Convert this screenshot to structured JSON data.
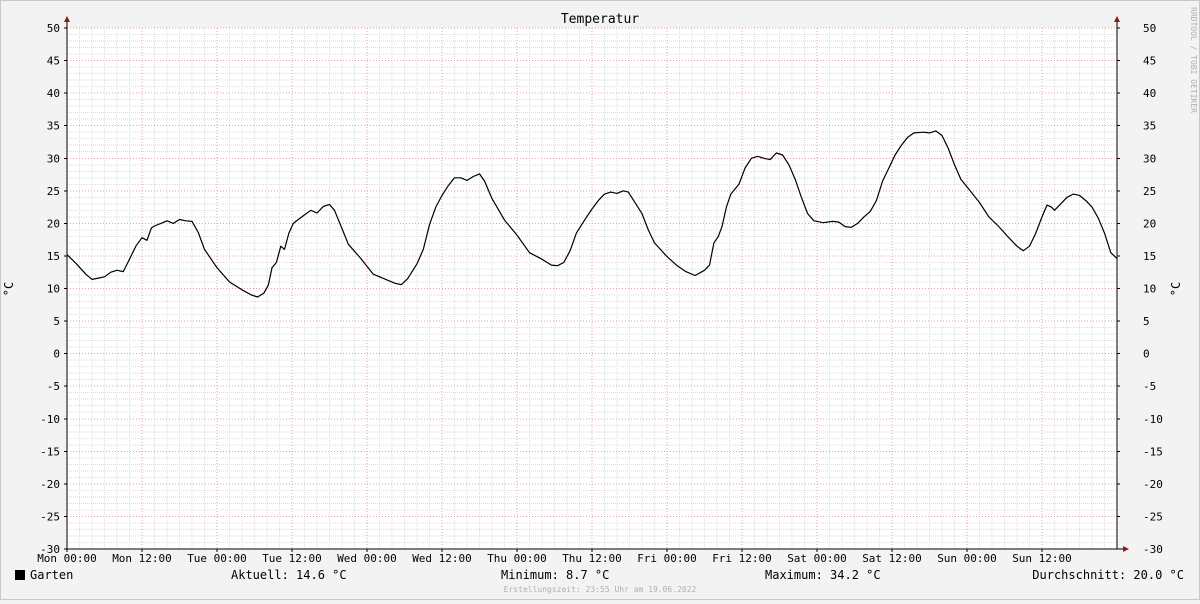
{
  "chart_data": {
    "type": "line",
    "title": "Temperatur",
    "ylabel": "°C",
    "ylim": [
      -30,
      50
    ],
    "yticks": [
      50,
      45,
      40,
      35,
      30,
      25,
      20,
      15,
      10,
      5,
      0,
      -5,
      -10,
      -15,
      -20,
      -25,
      -30
    ],
    "xlim": [
      0,
      168
    ],
    "xticks": [
      {
        "x": 0,
        "label": "Mon 00:00"
      },
      {
        "x": 12,
        "label": "Mon 12:00"
      },
      {
        "x": 24,
        "label": "Tue 00:00"
      },
      {
        "x": 36,
        "label": "Tue 12:00"
      },
      {
        "x": 48,
        "label": "Wed 00:00"
      },
      {
        "x": 60,
        "label": "Wed 12:00"
      },
      {
        "x": 72,
        "label": "Thu 00:00"
      },
      {
        "x": 84,
        "label": "Thu 12:00"
      },
      {
        "x": 96,
        "label": "Fri 00:00"
      },
      {
        "x": 108,
        "label": "Fri 12:00"
      },
      {
        "x": 120,
        "label": "Sat 00:00"
      },
      {
        "x": 132,
        "label": "Sat 12:00"
      },
      {
        "x": 144,
        "label": "Sun 00:00"
      },
      {
        "x": 156,
        "label": "Sun 12:00"
      }
    ],
    "grid": true,
    "series": [
      {
        "name": "Garten",
        "color": "#000000",
        "points": [
          [
            0,
            15.2
          ],
          [
            1.5,
            13.8
          ],
          [
            3,
            12.2
          ],
          [
            4,
            11.4
          ],
          [
            5,
            11.6
          ],
          [
            6,
            11.8
          ],
          [
            7,
            12.5
          ],
          [
            8,
            12.8
          ],
          [
            9,
            12.6
          ],
          [
            10,
            14.5
          ],
          [
            11,
            16.5
          ],
          [
            12,
            17.8
          ],
          [
            12.8,
            17.4
          ],
          [
            13.5,
            19.3
          ],
          [
            14,
            19.6
          ],
          [
            15,
            20.0
          ],
          [
            16,
            20.4
          ],
          [
            17,
            20.0
          ],
          [
            18,
            20.6
          ],
          [
            19,
            20.4
          ],
          [
            20,
            20.3
          ],
          [
            21,
            18.6
          ],
          [
            22,
            16.0
          ],
          [
            24,
            13.2
          ],
          [
            26,
            11.0
          ],
          [
            28,
            9.8
          ],
          [
            29.5,
            9.0
          ],
          [
            30.5,
            8.7
          ],
          [
            31.5,
            9.3
          ],
          [
            32.2,
            10.5
          ],
          [
            32.8,
            13.2
          ],
          [
            33.5,
            14.0
          ],
          [
            34.2,
            16.5
          ],
          [
            34.8,
            16.0
          ],
          [
            35.5,
            18.5
          ],
          [
            36.2,
            20.0
          ],
          [
            37,
            20.6
          ],
          [
            38,
            21.3
          ],
          [
            39,
            22.0
          ],
          [
            40,
            21.6
          ],
          [
            41,
            22.6
          ],
          [
            42,
            22.9
          ],
          [
            42.8,
            22.0
          ],
          [
            44,
            19.2
          ],
          [
            45,
            16.8
          ],
          [
            47,
            14.6
          ],
          [
            49,
            12.2
          ],
          [
            51,
            11.4
          ],
          [
            52.5,
            10.8
          ],
          [
            53.5,
            10.6
          ],
          [
            54.5,
            11.5
          ],
          [
            56,
            13.8
          ],
          [
            57,
            16.0
          ],
          [
            58,
            19.8
          ],
          [
            59,
            22.5
          ],
          [
            60,
            24.3
          ],
          [
            61,
            25.8
          ],
          [
            62,
            27.0
          ],
          [
            63,
            27.0
          ],
          [
            64,
            26.6
          ],
          [
            65,
            27.2
          ],
          [
            66,
            27.6
          ],
          [
            66.8,
            26.5
          ],
          [
            68,
            23.8
          ],
          [
            70,
            20.5
          ],
          [
            72,
            18.2
          ],
          [
            74,
            15.5
          ],
          [
            76,
            14.5
          ],
          [
            77.5,
            13.6
          ],
          [
            78.5,
            13.5
          ],
          [
            79.5,
            14.0
          ],
          [
            80.5,
            15.8
          ],
          [
            81.5,
            18.5
          ],
          [
            83,
            20.8
          ],
          [
            84,
            22.2
          ],
          [
            85,
            23.5
          ],
          [
            86,
            24.5
          ],
          [
            87,
            24.8
          ],
          [
            88,
            24.6
          ],
          [
            89,
            25.0
          ],
          [
            89.8,
            24.8
          ],
          [
            91,
            23.0
          ],
          [
            92,
            21.5
          ],
          [
            93,
            19.0
          ],
          [
            94,
            17.0
          ],
          [
            96,
            14.9
          ],
          [
            97.5,
            13.6
          ],
          [
            99,
            12.6
          ],
          [
            100.5,
            12.0
          ],
          [
            102,
            12.8
          ],
          [
            102.8,
            13.6
          ],
          [
            103.5,
            17.0
          ],
          [
            104.2,
            18.0
          ],
          [
            104.8,
            19.5
          ],
          [
            105.5,
            22.5
          ],
          [
            106.2,
            24.5
          ],
          [
            107.5,
            26.0
          ],
          [
            108.5,
            28.5
          ],
          [
            109.5,
            30.0
          ],
          [
            110.5,
            30.3
          ],
          [
            111.5,
            30.0
          ],
          [
            112.5,
            29.8
          ],
          [
            113.5,
            30.8
          ],
          [
            114.5,
            30.5
          ],
          [
            115.5,
            29.0
          ],
          [
            116.5,
            26.8
          ],
          [
            117.5,
            24.0
          ],
          [
            118.5,
            21.5
          ],
          [
            119.5,
            20.4
          ],
          [
            121,
            20.1
          ],
          [
            122.5,
            20.3
          ],
          [
            123.5,
            20.2
          ],
          [
            124.5,
            19.5
          ],
          [
            125.5,
            19.4
          ],
          [
            126.5,
            20.0
          ],
          [
            127.5,
            21.0
          ],
          [
            128.5,
            21.8
          ],
          [
            129.5,
            23.5
          ],
          [
            130.5,
            26.5
          ],
          [
            131.5,
            28.5
          ],
          [
            132.5,
            30.5
          ],
          [
            133.5,
            32.0
          ],
          [
            134.5,
            33.2
          ],
          [
            135.5,
            33.9
          ],
          [
            137,
            34.0
          ],
          [
            138,
            33.9
          ],
          [
            139,
            34.2
          ],
          [
            140,
            33.5
          ],
          [
            141,
            31.5
          ],
          [
            142,
            29.0
          ],
          [
            143,
            26.8
          ],
          [
            144.5,
            25.0
          ],
          [
            146,
            23.2
          ],
          [
            147.5,
            21.0
          ],
          [
            149,
            19.6
          ],
          [
            150.5,
            18.0
          ],
          [
            152,
            16.5
          ],
          [
            153,
            15.8
          ],
          [
            154,
            16.5
          ],
          [
            155,
            18.5
          ],
          [
            156,
            21.0
          ],
          [
            156.8,
            22.8
          ],
          [
            157.5,
            22.5
          ],
          [
            158,
            22.0
          ],
          [
            159,
            23.0
          ],
          [
            160,
            24.0
          ],
          [
            161,
            24.5
          ],
          [
            162,
            24.3
          ],
          [
            163,
            23.5
          ],
          [
            164,
            22.5
          ],
          [
            165,
            20.8
          ],
          [
            166,
            18.5
          ],
          [
            167,
            15.5
          ],
          [
            168,
            14.6
          ]
        ]
      }
    ]
  },
  "watermark": "RRDTOOL / TOBI OETIKER",
  "legend": {
    "series_name": "Garten",
    "current": "Aktuell: 14.6 °C",
    "minimum": "Minimum: 8.7 °C",
    "maximum": "Maximum: 34.2 °C",
    "average": "Durchschnitt: 20.0 °C"
  },
  "footer": "Erstellungszeit: 23:55 Uhr am 19.06.2022"
}
